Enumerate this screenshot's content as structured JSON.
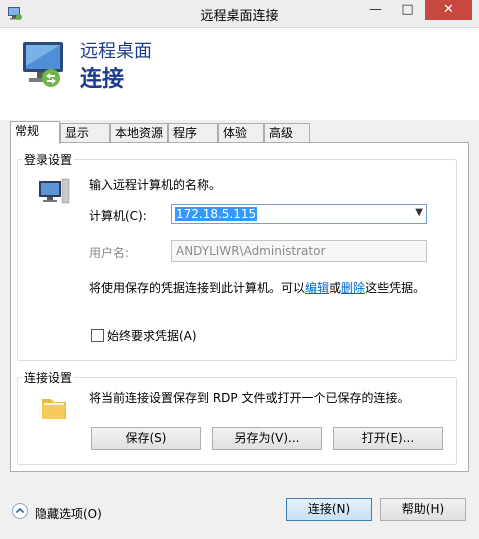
{
  "window": {
    "title": "远程桌面连接",
    "min_glyph": "—",
    "max_glyph": "□",
    "close_glyph": "✕"
  },
  "header": {
    "line1": "远程桌面",
    "line2": "连接"
  },
  "tabs": [
    {
      "label": "常规"
    },
    {
      "label": "显示"
    },
    {
      "label": "本地资源"
    },
    {
      "label": "程序"
    },
    {
      "label": "体验"
    },
    {
      "label": "高级"
    }
  ],
  "login": {
    "legend": "登录设置",
    "instruction": "输入远程计算机的名称。",
    "computer_label": "计算机(C):",
    "computer_value": "172.18.5.115",
    "username_label": "用户名:",
    "username_value": "ANDYLIWR\\Administrator",
    "creds_text_1": "将使用保存的凭据连接到此计算机。可以",
    "edit_link": "编辑",
    "or_text": "或",
    "delete_link": "删除",
    "creds_text_2": "这些凭据。",
    "always_ask_label": "始终要求凭据(A)"
  },
  "connection": {
    "legend": "连接设置",
    "description": "将当前连接设置保存到 RDP 文件或打开一个已保存的连接。",
    "save_label": "保存(S)",
    "save_as_label": "另存为(V)...",
    "open_label": "打开(E)..."
  },
  "footer": {
    "hide_options_label": "隐藏选项(O)",
    "connect_label": "连接(N)",
    "help_label": "帮助(H)"
  },
  "colors": {
    "header_text": "#1c3d8f",
    "link": "#0066cc",
    "close_button": "#c7483f",
    "selection": "#3399ff"
  }
}
